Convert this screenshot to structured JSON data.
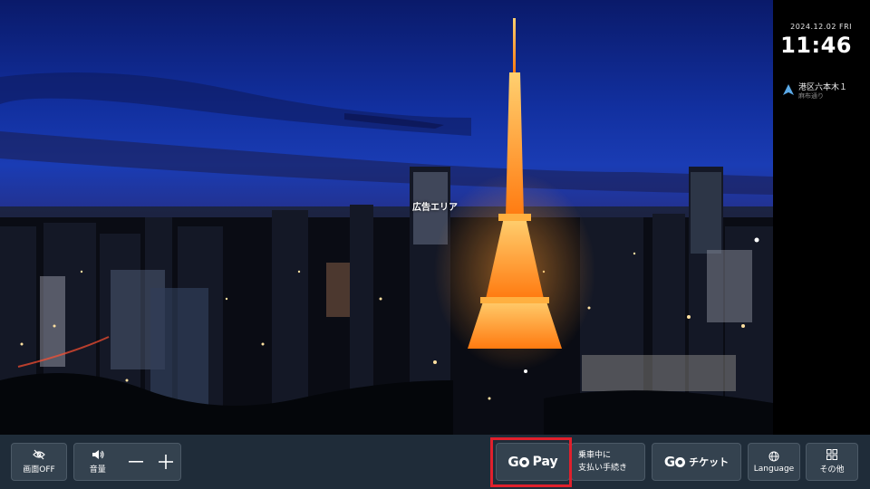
{
  "ad": {
    "label": "広告エリア"
  },
  "status_panel": {
    "date": "2024.12.02 FRI",
    "time": "11:46",
    "location_main": "港区六本木１",
    "location_sub": "麻布通り"
  },
  "toolbar": {
    "screen_off_label": "画面OFF",
    "volume_label": "音量",
    "gopay_go": "G",
    "gopay_pay": "Pay",
    "ride_pay_line1": "乗車中に",
    "ride_pay_line2": "支払い手続き",
    "ticket_go": "G",
    "ticket_label": "チケット",
    "language_label": "Language",
    "other_label": "その他"
  },
  "colors": {
    "toolbar_bg": "#1f2c39",
    "button_bg": "#34424f",
    "highlight_red": "#e0202c",
    "location_arrow": "#5aa8e6"
  },
  "icons": {
    "screen_off": "eye-slash-icon",
    "volume": "speaker-icon",
    "volume_down": "minus-icon",
    "volume_up": "plus-icon",
    "language": "globe-icon",
    "other": "grid-icon",
    "location": "navigation-arrow-icon"
  }
}
